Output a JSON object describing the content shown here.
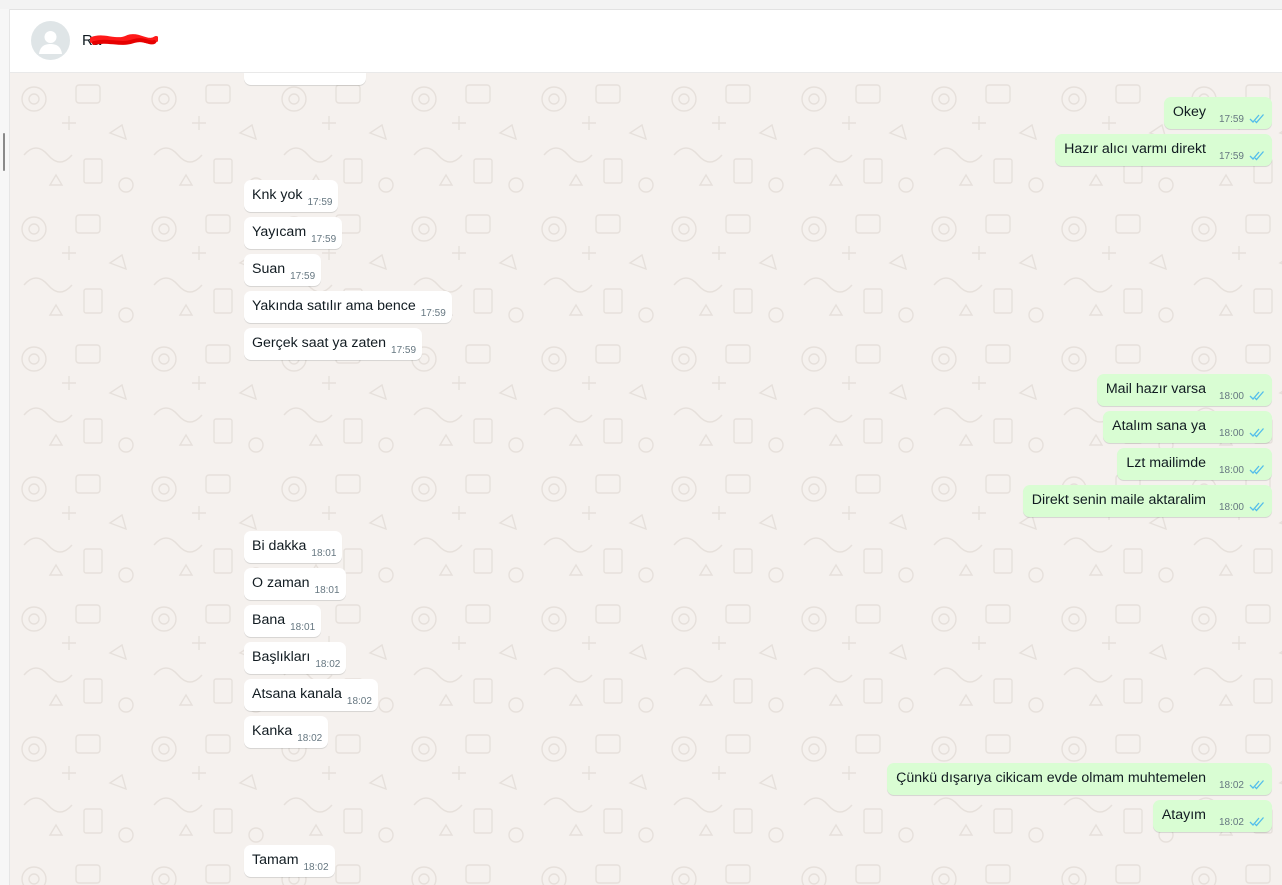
{
  "header": {
    "contact_name": "Ra"
  },
  "colors": {
    "outgoing_bubble": "#d9fdd3",
    "incoming_bubble": "#ffffff",
    "chat_background": "#f5f1ee",
    "read_ticks": "#53bdeb"
  },
  "icons": {
    "avatar": "person-silhouette-icon",
    "read_receipt": "double-check-icon"
  },
  "messages": [
    {
      "dir": "out",
      "text": "Okey",
      "time": "17:59"
    },
    {
      "dir": "out",
      "text": "Hazır alıcı varmı direkt",
      "time": "17:59"
    },
    {
      "dir": "in",
      "text": "Knk yok",
      "time": "17:59"
    },
    {
      "dir": "in",
      "text": "Yayıcam",
      "time": "17:59"
    },
    {
      "dir": "in",
      "text": "Suan",
      "time": "17:59"
    },
    {
      "dir": "in",
      "text": "Yakında satılır ama bence",
      "time": "17:59"
    },
    {
      "dir": "in",
      "text": "Gerçek saat ya zaten",
      "time": "17:59"
    },
    {
      "dir": "out",
      "text": "Mail hazır varsa",
      "time": "18:00"
    },
    {
      "dir": "out",
      "text": "Atalım sana ya",
      "time": "18:00"
    },
    {
      "dir": "out",
      "text": "Lzt mailimde",
      "time": "18:00"
    },
    {
      "dir": "out",
      "text": "Direkt senin maile aktaralim",
      "time": "18:00"
    },
    {
      "dir": "in",
      "text": "Bi dakka",
      "time": "18:01"
    },
    {
      "dir": "in",
      "text": "O zaman",
      "time": "18:01"
    },
    {
      "dir": "in",
      "text": "Bana",
      "time": "18:01"
    },
    {
      "dir": "in",
      "text": "Başlıkları",
      "time": "18:02"
    },
    {
      "dir": "in",
      "text": "Atsana kanala",
      "time": "18:02"
    },
    {
      "dir": "in",
      "text": "Kanka",
      "time": "18:02"
    },
    {
      "dir": "out",
      "text": "Çünkü dışarıya cikicam evde olmam muhtemelen",
      "time": "18:02"
    },
    {
      "dir": "out",
      "text": "Atayım",
      "time": "18:02"
    },
    {
      "dir": "in",
      "text": "Tamam",
      "time": "18:02"
    }
  ]
}
